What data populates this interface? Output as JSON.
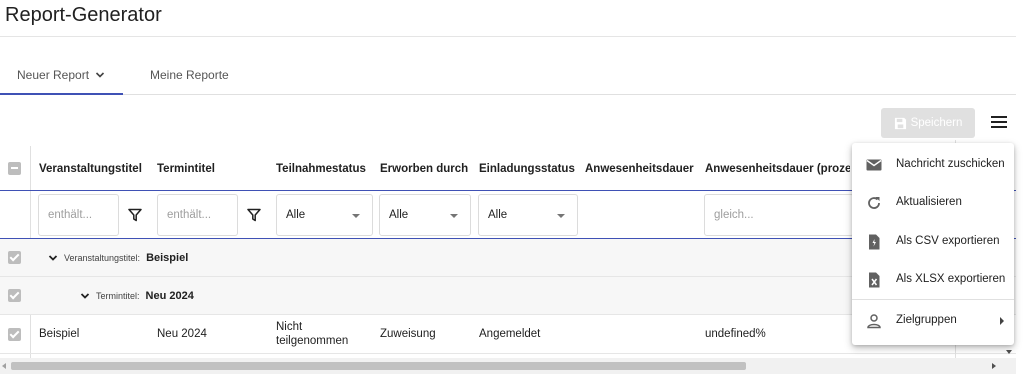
{
  "app": {
    "title": "Report-Generator"
  },
  "tabs": [
    {
      "label": "Neuer Report"
    },
    {
      "label": "Meine Reporte"
    }
  ],
  "toolbar": {
    "save_label": "Speichern"
  },
  "table": {
    "columns": [
      "Veranstaltungstitel",
      "Termintitel",
      "Teilnahmestatus",
      "Erworben durch",
      "Einladungsstatus",
      "Anwesenheitsdauer",
      "Anwesenheitsdauer (prozentual)"
    ],
    "filters": {
      "text_placeholder": "enthält...",
      "teilnahmestatus": "Alle",
      "erworben_durch": "Alle",
      "einladungsstatus": "Alle",
      "anwesenheit_prozent_placeholder": "gleich..."
    },
    "groups": [
      {
        "label": "Veranstaltungstitel:",
        "value": "Beispiel"
      },
      {
        "label": "Termintitel:",
        "value": "Neu 2024"
      }
    ],
    "rows": [
      {
        "veranstaltungstitel": "Beispiel",
        "termintitel": "Neu 2024",
        "teilnahmestatus": "Nicht teilgenommen",
        "erworben_durch": "Zuweisung",
        "einladungsstatus": "Angemeldet",
        "anwesenheitsdauer": "",
        "anwesenheitsdauer_prozent": "undefined%"
      }
    ]
  },
  "menu": {
    "items": [
      {
        "label": "Nachricht zuschicken",
        "icon": "mail-icon"
      },
      {
        "label": "Aktualisieren",
        "icon": "refresh-icon"
      },
      {
        "label": "Als CSV exportieren",
        "icon": "csv-file-icon"
      },
      {
        "label": "Als XLSX exportieren",
        "icon": "xlsx-file-icon"
      },
      {
        "label": "Zielgruppen",
        "icon": "person-icon"
      }
    ]
  },
  "colors": {
    "accent": "#3f51b5",
    "disabled_button": "#e0e0e0",
    "group_row": "#f7f7f7"
  }
}
